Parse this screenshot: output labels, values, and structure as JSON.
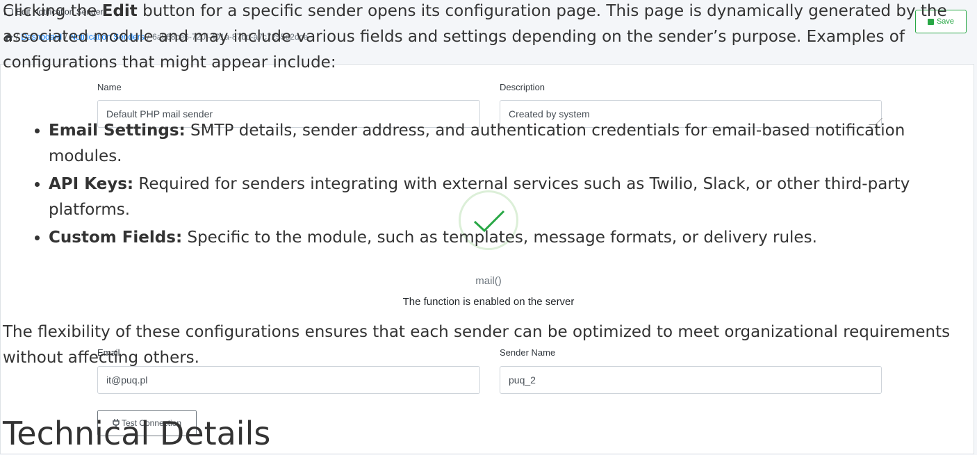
{
  "app": {
    "page_title": "Edit Notification Sender",
    "breadcrumb": {
      "home_icon": "home-icon",
      "items": [
        "Dashboard",
        "Notification Senders",
        "6a968ce6-720f-401a-87bd-a7c7255d2dce"
      ]
    },
    "save_label": "Save",
    "form": {
      "name_label": "Name",
      "name_value": "Default PHP mail sender",
      "description_label": "Description",
      "description_value": "Created by system",
      "function_name": "mail()",
      "function_status": "The function is enabled on the server",
      "email_label": "Email",
      "email_value": "it@puq.pl",
      "sender_name_label": "Sender Name",
      "sender_name_value": "puq_2",
      "test_label": "Test Connection"
    },
    "colors": {
      "success": "#28a745",
      "link": "#007bff"
    }
  },
  "doc": {
    "intro_pre": "Clicking the ",
    "intro_bold": "Edit",
    "intro_post": " button for a specific sender opens its configuration page. This page is dynamically generated by the associated module and may include various fields and settings depending on the sender’s purpose. Examples of configurations that might appear include:",
    "bullets": [
      {
        "title": "Email Settings:",
        "text": " SMTP details, sender address, and authentication credentials for email-based notification modules."
      },
      {
        "title": "API Keys:",
        "text": " Required for senders integrating with external services such as Twilio, Slack, or other third-party platforms."
      },
      {
        "title": "Custom Fields:",
        "text": " Specific to the module, such as templates, message formats, or delivery rules."
      }
    ],
    "closing": "The flexibility of these configurations ensures that each sender can be optimized to meet organizational requirements without affecting others.",
    "heading": "Technical Details"
  }
}
